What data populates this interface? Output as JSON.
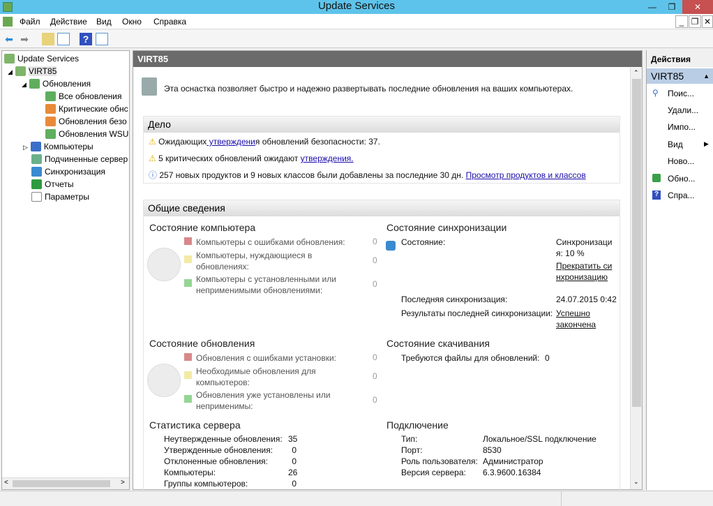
{
  "window": {
    "title": "Update Services",
    "minimize": "—",
    "maximize": "❐",
    "close": "✕"
  },
  "menu": [
    "Файл",
    "Действие",
    "Вид",
    "Окно",
    "Справка"
  ],
  "tree": {
    "root": "Update Services",
    "server": "VIRT85",
    "updates": "Обновления",
    "all": "Все обновления",
    "critical": "Критические обнс",
    "security": "Обновления безо",
    "wsus": "Обновления WSUS",
    "computers": "Компьютеры",
    "downstream": "Подчиненные сервер",
    "sync": "Синхронизация",
    "reports": "Отчеты",
    "options": "Параметры"
  },
  "center": {
    "header": "VIRT85",
    "intro": "Эта оснастка позволяет быстро и надежно развертывать последние обновления на ваших компьютерах.",
    "todo": {
      "title": "Дело",
      "item1_a": "Ожидающих",
      "item1_link": " утверждени",
      "item1_b": "я обновлений безопасности: 37.",
      "item2_a": "5 критических обновлений ожидают ",
      "item2_link": "утверждения.",
      "item3_a": "257 новых продуктов и 9 новых классов были добавлены за последние 30 дн. ",
      "item3_link": "Просмотр продуктов и классов"
    },
    "overview": {
      "title": "Общие сведения",
      "computer_status": {
        "title": "Состояние компьютера",
        "rows": [
          {
            "label": "Компьютеры с ошибками обновления:",
            "value": "0",
            "color": "#d9888a"
          },
          {
            "label": "Компьютеры, нуждающиеся в обновлениях:",
            "value": "0",
            "color": "#f3eaa6"
          },
          {
            "label": "Компьютеры с установленными или неприменимыми обновлениями:",
            "value": "0",
            "color": "#93d693"
          }
        ]
      },
      "update_status": {
        "title": "Состояние обновления",
        "rows": [
          {
            "label": "Обновления с ошибками установки:",
            "value": "0",
            "color": "#d9888a"
          },
          {
            "label": "Необходимые обновления для компьютеров:",
            "value": "0",
            "color": "#f3eaa6"
          },
          {
            "label": "Обновления уже установлены или неприменимы:",
            "value": "0",
            "color": "#93d693"
          }
        ]
      },
      "sync_status": {
        "title": "Состояние синхронизации",
        "state_label": "Состояние:",
        "state_value": "Синхронизация: 10 %",
        "stop_link": "Прекратить синхронизацию",
        "last_label": "Последняя синхронизация:",
        "last_value": "24.07.2015 0:42",
        "result_label": "Результаты последней синхронизации:",
        "result_link": "Успешно закончена"
      },
      "download_status": {
        "title": "Состояние скачивания",
        "label": "Требуются файлы для обновлений:",
        "value": "0"
      },
      "server_stats": {
        "title": "Статистика сервера",
        "rows": [
          {
            "label": "Неутвержденные обновления:",
            "value": "35"
          },
          {
            "label": "Утвержденные обновления:",
            "value": "0"
          },
          {
            "label": "Отклоненные обновления:",
            "value": "0"
          },
          {
            "label": "Компьютеры:",
            "value": "26"
          },
          {
            "label": "Группы компьютеров:",
            "value": "0"
          }
        ]
      },
      "connection": {
        "title": "Подключение",
        "rows": [
          {
            "label": "Тип:",
            "value": "Локальное/SSL подключение"
          },
          {
            "label": "Порт:",
            "value": "8530"
          },
          {
            "label": "Роль пользователя:",
            "value": "Администратор"
          },
          {
            "label": "Версия сервера:",
            "value": "6.3.9600.16384"
          }
        ]
      }
    }
  },
  "actions": {
    "title": "Действия",
    "group": "VIRT85",
    "items": [
      "Поис...",
      "Удали...",
      "Импо...",
      "Вид",
      "Ново...",
      "Обно...",
      "Спра..."
    ]
  }
}
